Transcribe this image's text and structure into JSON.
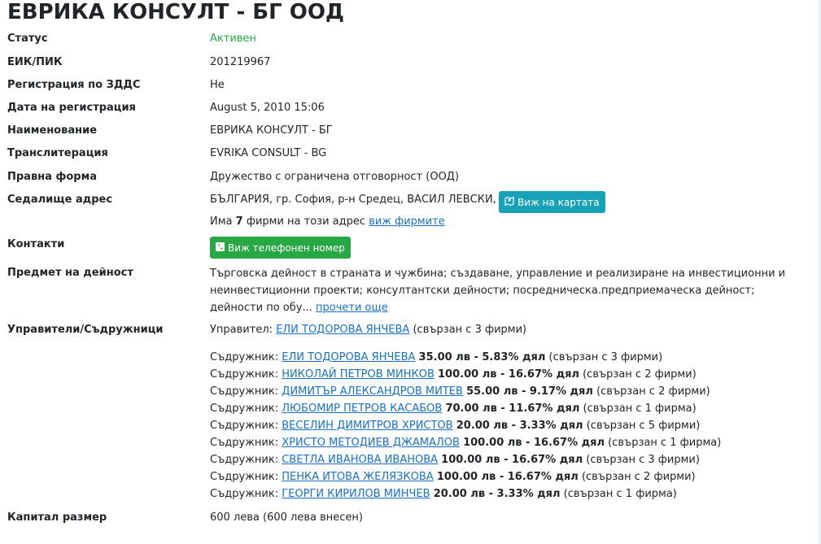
{
  "company": {
    "title": "ЕВРИКА КОНСУЛТ - БГ ООД"
  },
  "fields": {
    "status": {
      "label": "Статус",
      "value": "Активен"
    },
    "eik": {
      "label": "ЕИК/ПИК",
      "value": "201219967"
    },
    "vat": {
      "label": "Регистрация по ЗДДС",
      "value": "Не"
    },
    "reg_date": {
      "label": "Дата на регистрация",
      "value": "August 5, 2010 15:06"
    },
    "name": {
      "label": "Наименование",
      "value": "ЕВРИКА КОНСУЛТ - БГ"
    },
    "translit": {
      "label": "Транслитерация",
      "value": "EVRIKA CONSULT - BG"
    },
    "legal_form": {
      "label": "Правна форма",
      "value": "Дружество с ограничена отговорност (ООД)"
    },
    "address": {
      "label": "Седалище адрес",
      "value": "БЪЛГАРИЯ, гр. София, р-н Средец, ВАСИЛ ЛЕВСКИ, 3",
      "map_button": "Виж на картата",
      "firms_prefix": "Има",
      "firms_count": "7",
      "firms_suffix": "фирми на този адрес",
      "firms_link": "виж фирмите"
    },
    "contacts": {
      "label": "Контакти",
      "phone_button": "Виж телефонен номер"
    },
    "activity": {
      "label": "Предмет на дейност",
      "value": "Търговска дейност в страната и чужбина; създаване, управление и реализиране на инвестиционни и неинвестиционни проекти; консултантски дейности; посредническа.предприемаческа дейност; дейности по обу...",
      "read_more": "прочети още"
    },
    "managers": {
      "label": "Управители/Съдружници",
      "manager_prefix": "Управител:",
      "manager_name": "ЕЛИ ТОДОРОВА ЯНЧЕВА",
      "manager_suffix": "(свързан с 3 фирми)"
    },
    "capital": {
      "label": "Капитал размер",
      "value": "600 лева (600 лева внесен)"
    }
  },
  "partners": [
    {
      "prefix": "Съдружник:",
      "name": "ЕЛИ ТОДОРОВА ЯНЧЕВА",
      "share": "35.00 лв - 5.83% дял",
      "linked": "(свързан с 3 фирми)"
    },
    {
      "prefix": "Съдружник:",
      "name": "НИКОЛАЙ ПЕТРОВ МИНКОВ",
      "share": "100.00 лв - 16.67% дял",
      "linked": "(свързан с 2 фирми)"
    },
    {
      "prefix": "Съдружник:",
      "name": "ДИМИТЪР АЛЕКСАНДРОВ МИТЕВ",
      "share": "55.00 лв - 9.17% дял",
      "linked": "(свързан с 2 фирми)"
    },
    {
      "prefix": "Съдружник:",
      "name": "ЛЮБОМИР ПЕТРОВ КАСАБОВ",
      "share": "70.00 лв - 11.67% дял",
      "linked": "(свързан с 1 фирма)"
    },
    {
      "prefix": "Съдружник:",
      "name": "ВЕСЕЛИН ДИМИТРОВ ХРИСТОВ",
      "share": "20.00 лв - 3.33% дял",
      "linked": "(свързан с 5 фирми)"
    },
    {
      "prefix": "Съдружник:",
      "name": "ХРИСТО МЕТОДИЕВ ДЖАМАЛОВ",
      "share": "100.00 лв - 16.67% дял",
      "linked": "(свързан с 1 фирма)"
    },
    {
      "prefix": "Съдружник:",
      "name": "СВЕТЛА ИВАНОВА ИВАНОВА",
      "share": "100.00 лв - 16.67% дял",
      "linked": "(свързан с 3 фирми)"
    },
    {
      "prefix": "Съдружник:",
      "name": "ПЕНКА ИТОВА ЖЕЛЯЗКОВА",
      "share": "100.00 лв - 16.67% дял",
      "linked": "(свързан с 2 фирми)"
    },
    {
      "prefix": "Съдружник:",
      "name": "ГЕОРГИ КИРИЛОВ МИНЧЕВ",
      "share": "20.00 лв - 3.33% дял",
      "linked": "(свързан с 1 фирма)"
    }
  ],
  "colors": {
    "status_active": "#28a745",
    "link": "#1a6fc9",
    "map_button": "#17a2b8",
    "phone_button": "#28a745"
  },
  "icons": {
    "map_button": "map-marker-icon",
    "phone_button": "phone-square-icon"
  }
}
